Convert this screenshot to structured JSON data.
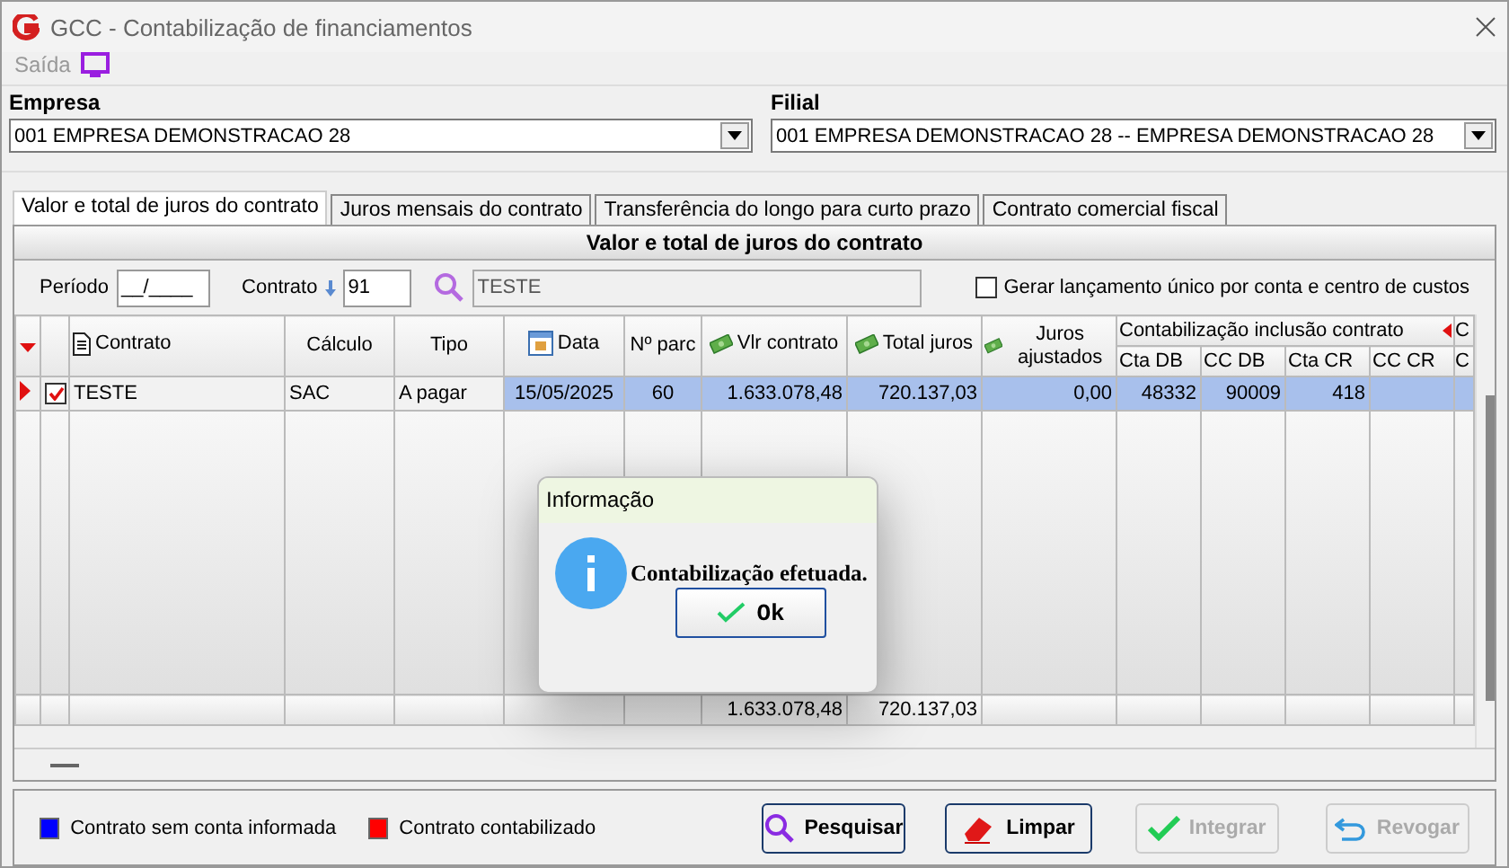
{
  "window": {
    "title": "GCC - Contabilização de financiamentos"
  },
  "menu": [
    {
      "label": "Saída",
      "disabled": true
    }
  ],
  "empresa": {
    "label": "Empresa",
    "value": "001 EMPRESA DEMONSTRACAO 28"
  },
  "filial": {
    "label": "Filial",
    "value": "001 EMPRESA DEMONSTRACAO 28 -- EMPRESA DEMONSTRACAO 28"
  },
  "tabs": [
    {
      "label": "Valor e total de juros do contrato",
      "selected": true
    },
    {
      "label": "Juros mensais do contrato",
      "selected": false
    },
    {
      "label": "Transferência do longo para curto prazo",
      "selected": false
    },
    {
      "label": "Contrato comercial fiscal",
      "selected": false
    }
  ],
  "panel": {
    "title": "Valor e total de juros do contrato"
  },
  "filters": {
    "periodo": {
      "label": "Período",
      "value": "__/____"
    },
    "contrato": {
      "label": "Contrato",
      "value": "91"
    },
    "contrato_nome": "TESTE",
    "single_entry": {
      "label": "Gerar lançamento único por conta e centro de custos",
      "checked": false
    }
  },
  "grid": {
    "group_header": "Contabilização inclusão contrato",
    "cut_header": "C",
    "columns": [
      "Contrato",
      "Cálculo",
      "Tipo",
      "Data",
      "Nº parc",
      "Vlr contrato",
      "Total juros",
      "Juros ajustados"
    ],
    "sub_columns": [
      "Cta DB",
      "CC DB",
      "Cta CR",
      "CC CR",
      "C"
    ],
    "rows": [
      {
        "current": true,
        "checked": true,
        "selected": true,
        "cells": [
          "TESTE",
          "SAC",
          "A pagar",
          "15/05/2025",
          "60",
          "1.633.078,48",
          "720.137,03",
          "0,00",
          "48332",
          "90009",
          "418",
          "",
          ""
        ]
      }
    ],
    "totals": {
      "vlr_contrato": "1.633.078,48",
      "total_juros": "720.137,03"
    }
  },
  "dialog": {
    "title": "Informação",
    "message": "Contabilização efetuada.",
    "button": "Ok"
  },
  "legend": [
    {
      "label": "Contrato sem conta informada",
      "color": "#0000ff"
    },
    {
      "label": "Contrato contabilizado",
      "color": "#ff0000"
    }
  ],
  "buttons": [
    {
      "label": "Pesquisar",
      "kind": "search",
      "disabled": false
    },
    {
      "label": "Limpar",
      "kind": "eraser",
      "disabled": false
    },
    {
      "label": "Integrar",
      "kind": "check",
      "disabled": true
    },
    {
      "label": "Revogar",
      "kind": "undo",
      "disabled": true
    }
  ]
}
